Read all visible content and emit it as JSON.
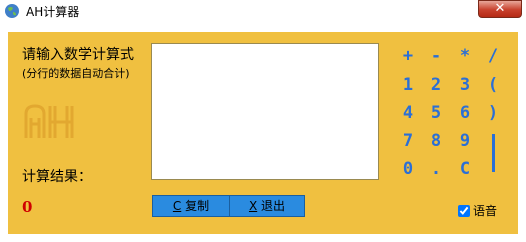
{
  "window": {
    "title": "AH计算器",
    "close_label": "✕"
  },
  "prompt": {
    "line1": "请输入数学计算式",
    "line2": "(分行的数据自动合计)"
  },
  "result": {
    "label": "计算结果：",
    "value": "0"
  },
  "input": {
    "value": ""
  },
  "buttons": {
    "copy": {
      "hotkey": "C",
      "label": "复制"
    },
    "exit": {
      "hotkey": "X",
      "label": "退出"
    }
  },
  "keypad": {
    "plus": "+",
    "minus": "-",
    "multiply": "*",
    "divide": "/",
    "k1": "1",
    "k2": "2",
    "k3": "3",
    "lparen": "(",
    "k4": "4",
    "k5": "5",
    "k6": "6",
    "rparen": ")",
    "k7": "7",
    "k8": "8",
    "k9": "9",
    "k0": "0",
    "dot": ".",
    "clear": "C"
  },
  "voice": {
    "label": "语音",
    "checked": true
  },
  "colors": {
    "panel": "#f0c040",
    "key": "#2b6fd6",
    "result": "#d00000",
    "button": "#2a8be0"
  }
}
